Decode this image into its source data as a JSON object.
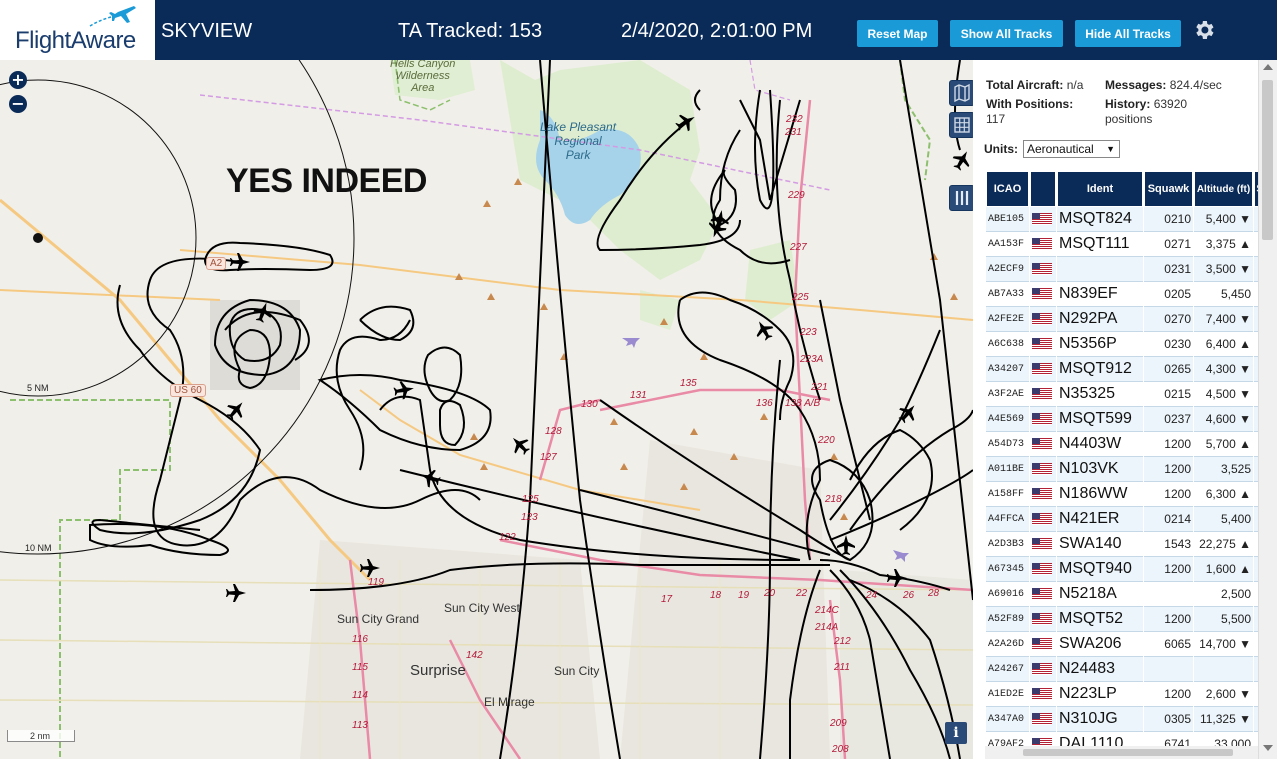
{
  "header": {
    "logo_text": "FlightAware",
    "app_title": "SKYVIEW",
    "tracked_label": "TA Tracked: 153",
    "clock": "2/4/2020, 2:01:00 PM",
    "reset_map": "Reset Map",
    "show_all_tracks": "Show All Tracks",
    "hide_all_tracks": "Hide All Tracks"
  },
  "map": {
    "annotation": "YES INDEED",
    "zoom_in": "+",
    "zoom_out": "−",
    "info": "i",
    "scale_bar": "2 nm",
    "range_rings": [
      "5 NM",
      "10 NM"
    ],
    "places_small": [
      "Sun City Grand",
      "Sun City West",
      "Sun City",
      "El Mirage"
    ],
    "place_large": "Surprise",
    "park_label": "Hells Canyon\nWilderness\nArea",
    "lake_label": "Lake Pleasant\nRegional\nPark",
    "shields": [
      "US 60",
      "A2"
    ],
    "exit_numbers": [
      "232",
      "231",
      "229",
      "227",
      "225",
      "223",
      "223A",
      "221",
      "220",
      "218",
      "136",
      "138 A/B",
      "135",
      "131",
      "130",
      "128",
      "127",
      "125",
      "123",
      "122",
      "119",
      "116",
      "115",
      "114",
      "113",
      "142",
      "214C",
      "214A",
      "212",
      "211",
      "209",
      "208",
      "17",
      "18",
      "19",
      "20",
      "22",
      "24",
      "26",
      "28"
    ],
    "colors": {
      "land": "#f1efe9",
      "water": "#a7d3ea",
      "park": "#d6ecc4",
      "tracks": "#000000",
      "road_major": "#f5c982",
      "highway": "#e98aa6"
    },
    "aircraft_icon": "airplane-icon"
  },
  "panel": {
    "stats": {
      "total_aircraft_label": "Total Aircraft:",
      "total_aircraft_value": "n/a",
      "messages_label": "Messages:",
      "messages_value": "824.4/sec",
      "with_positions_label": "With Positions:",
      "with_positions_value": "117",
      "history_label": "History:",
      "history_value": "63920 positions"
    },
    "units_label": "Units:",
    "units_value": "Aeronautical",
    "columns": [
      "ICAO",
      "",
      "Ident",
      "Squawk",
      "Altitude (ft)",
      "S"
    ],
    "rows": [
      {
        "icao": "ABE105",
        "ident": "MSQT824",
        "squawk": "0210",
        "alt": "5,400 ▼"
      },
      {
        "icao": "AA153F",
        "ident": "MSQT111",
        "squawk": "0271",
        "alt": "3,375 ▲"
      },
      {
        "icao": "A2ECF9",
        "ident": "",
        "squawk": "0231",
        "alt": "3,500 ▼"
      },
      {
        "icao": "AB7A33",
        "ident": "N839EF",
        "squawk": "0205",
        "alt": "5,450"
      },
      {
        "icao": "A2FE2E",
        "ident": "N292PA",
        "squawk": "0270",
        "alt": "7,400 ▼"
      },
      {
        "icao": "A6C638",
        "ident": "N5356P",
        "squawk": "0230",
        "alt": "6,400 ▲"
      },
      {
        "icao": "A34207",
        "ident": "MSQT912",
        "squawk": "0265",
        "alt": "4,300 ▼"
      },
      {
        "icao": "A3F2AE",
        "ident": "N35325",
        "squawk": "0215",
        "alt": "4,500 ▼"
      },
      {
        "icao": "A4E569",
        "ident": "MSQT599",
        "squawk": "0237",
        "alt": "4,600 ▼"
      },
      {
        "icao": "A54D73",
        "ident": "N4403W",
        "squawk": "1200",
        "alt": "5,700 ▲"
      },
      {
        "icao": "A011BE",
        "ident": "N103VK",
        "squawk": "1200",
        "alt": "3,525"
      },
      {
        "icao": "A158FF",
        "ident": "N186WW",
        "squawk": "1200",
        "alt": "6,300 ▲"
      },
      {
        "icao": "A4FFCA",
        "ident": "N421ER",
        "squawk": "0214",
        "alt": "5,400"
      },
      {
        "icao": "A2D3B3",
        "ident": "SWA140",
        "squawk": "1543",
        "alt": "22,275 ▲"
      },
      {
        "icao": "A67345",
        "ident": "MSQT940",
        "squawk": "1200",
        "alt": "1,600 ▲"
      },
      {
        "icao": "A69016",
        "ident": "N5218A",
        "squawk": "",
        "alt": "2,500"
      },
      {
        "icao": "A52F89",
        "ident": "MSQT52",
        "squawk": "1200",
        "alt": "5,500"
      },
      {
        "icao": "A2A26D",
        "ident": "SWA206",
        "squawk": "6065",
        "alt": "14,700 ▼"
      },
      {
        "icao": "A24267",
        "ident": "N24483",
        "squawk": "",
        "alt": ""
      },
      {
        "icao": "A1ED2E",
        "ident": "N223LP",
        "squawk": "1200",
        "alt": "2,600 ▼"
      },
      {
        "icao": "A347A0",
        "ident": "N310JG",
        "squawk": "0305",
        "alt": "11,325 ▼"
      },
      {
        "icao": "A79AF2",
        "ident": "DAL1110",
        "squawk": "6741",
        "alt": "33,000"
      }
    ]
  },
  "flag_colors": {
    "red": "#b22234",
    "white": "#ffffff",
    "blue": "#3c3b6e"
  }
}
